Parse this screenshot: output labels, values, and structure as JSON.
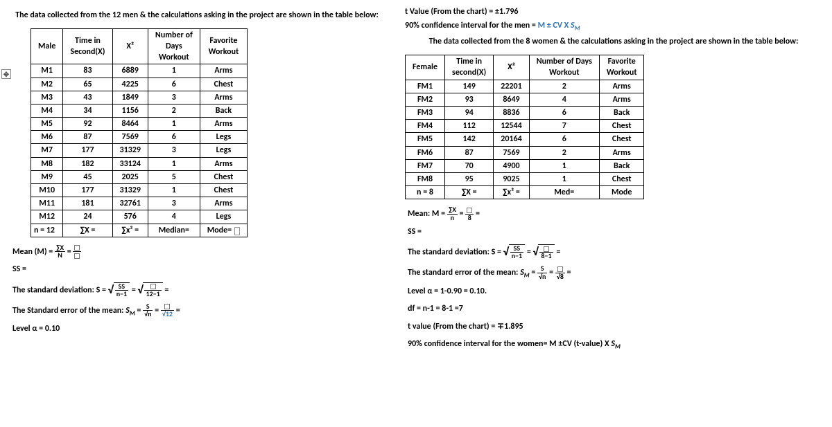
{
  "top": {
    "t_value": "t Value (From the chart) = ±1.796",
    "ci_men_prefix": "90% confidence interval for the men = ",
    "ci_men_rhs": "M ± CV X",
    "sm": "S",
    "sm_sub": "M"
  },
  "left": {
    "heading": "The data collected from the 12 men & the calculations asking in the project are shown in the table below:",
    "headers": {
      "c1": "Male",
      "c2": "Time in Second(X)",
      "c3": "X²",
      "c4": "Number of Days Workout",
      "c5": "Favorite Workout"
    },
    "rows": [
      {
        "id": "M1",
        "x": "83",
        "x2": "6889",
        "days": "1",
        "fav": "Arms"
      },
      {
        "id": "M2",
        "x": "65",
        "x2": "4225",
        "days": "6",
        "fav": "Chest"
      },
      {
        "id": "M3",
        "x": "43",
        "x2": "1849",
        "days": "3",
        "fav": "Arms"
      },
      {
        "id": "M4",
        "x": "34",
        "x2": "1156",
        "days": "2",
        "fav": "Back"
      },
      {
        "id": "M5",
        "x": "92",
        "x2": "8464",
        "days": "1",
        "fav": "Arms"
      },
      {
        "id": "M6",
        "x": "87",
        "x2": "7569",
        "days": "6",
        "fav": "Legs"
      },
      {
        "id": "M7",
        "x": "177",
        "x2": "31329",
        "days": "3",
        "fav": "Legs"
      },
      {
        "id": "M8",
        "x": "182",
        "x2": "33124",
        "days": "1",
        "fav": "Arms"
      },
      {
        "id": "M9",
        "x": "45",
        "x2": "2025",
        "days": "5",
        "fav": "Chest"
      },
      {
        "id": "M10",
        "x": "177",
        "x2": "31329",
        "days": "1",
        "fav": "Chest"
      },
      {
        "id": "M11",
        "x": "181",
        "x2": "32761",
        "days": "3",
        "fav": "Arms"
      },
      {
        "id": "M12",
        "x": "24",
        "x2": "576",
        "days": "4",
        "fav": "Legs"
      }
    ],
    "summary": {
      "n": "n = 12",
      "sx": "∑X =",
      "sx2": "∑x² =",
      "median": "Median=",
      "mode": "Mode="
    },
    "formulas": {
      "mean_label": "Mean (M) =",
      "mean_frac_num": "∑X",
      "mean_frac_den": "N",
      "ss": "SS =",
      "sd_label": "The standard deviation: S =",
      "sd_frac_num": "SS",
      "sd_frac_den": "n−1",
      "sd_frac2_den": "12−1",
      "sem_label": "The Standard error of the mean:",
      "sem_sym": "S",
      "sem_sub": "M",
      "sem_num": "S",
      "sem_den": "√n",
      "sem_den2": "√12",
      "alpha": "Level α = 0.10"
    }
  },
  "right": {
    "heading": "The data collected from the 8 women & the calculations asking in the project are shown in the table below:",
    "headers": {
      "c1": "Female",
      "c2": "Time in second(X)",
      "c3": "X²",
      "c4": "Number of Days Workout",
      "c5": "Favorite Workout"
    },
    "rows": [
      {
        "id": "FM1",
        "x": "149",
        "x2": "22201",
        "days": "2",
        "fav": "Arms"
      },
      {
        "id": "FM2",
        "x": "93",
        "x2": "8649",
        "days": "4",
        "fav": "Arms"
      },
      {
        "id": "FM3",
        "x": "94",
        "x2": "8836",
        "days": "6",
        "fav": "Back"
      },
      {
        "id": "FM4",
        "x": "112",
        "x2": "12544",
        "days": "7",
        "fav": "Chest"
      },
      {
        "id": "FM5",
        "x": "142",
        "x2": "20164",
        "days": "6",
        "fav": "Chest"
      },
      {
        "id": "FM6",
        "x": "87",
        "x2": "7569",
        "days": "2",
        "fav": "Arms"
      },
      {
        "id": "FM7",
        "x": "70",
        "x2": "4900",
        "days": "1",
        "fav": "Back"
      },
      {
        "id": "FM8",
        "x": "95",
        "x2": "9025",
        "days": "1",
        "fav": "Chest"
      }
    ],
    "summary": {
      "n": "n = 8",
      "sx": "∑X =",
      "sx2": "∑x² =",
      "med": "Med=",
      "mode": "Mode"
    },
    "formulas": {
      "mean_label": "Mean: M =",
      "mean_num": "∑X",
      "mean_den": "n",
      "mean_den2": "8",
      "ss": "SS =",
      "sd_label": "The standard deviation: S =",
      "sd_num": "SS",
      "sd_den": "n−1",
      "sd_den2": "8−1",
      "sem_label": "The standard error of the mean:",
      "sem_sym": "S",
      "sem_sub": "M",
      "sem_num": "S",
      "sem_den": "√n",
      "sem_den2": "√8",
      "alpha": "Level α = 1-0.90 = 0.10.",
      "df": "df = n-1 = 8-1 =7",
      "tval": "t value (From the chart) = ∓1.895",
      "ci_label": "90% confidence interval for the women= M ±CV (t-value) X",
      "ci_sm": "S",
      "ci_sm_sub": "M"
    }
  }
}
